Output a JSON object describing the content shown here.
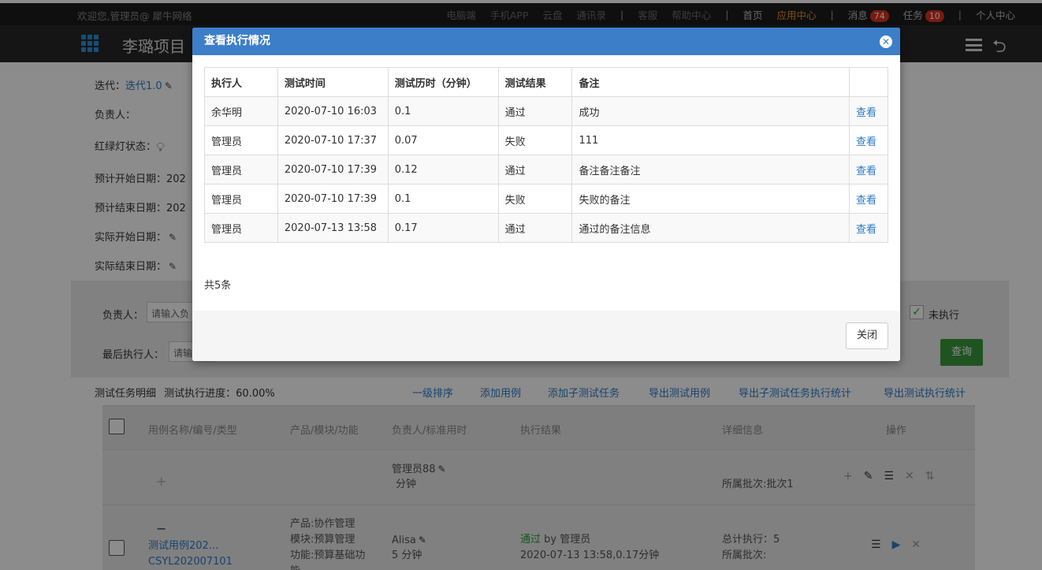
{
  "topbar": {
    "welcome": "欢迎您,管理员@ 犀牛网络",
    "links": [
      "电脑端",
      "手机APP",
      "云盘",
      "通讯录"
    ],
    "links2": [
      "客服",
      "帮助中心"
    ],
    "home": "首页",
    "app_center": "应用中心",
    "messages_label": "消息",
    "messages_count": "74",
    "tasks_label": "任务",
    "tasks_count": "10",
    "personal": "个人中心"
  },
  "project": {
    "name": "李璐项目"
  },
  "info": {
    "iteration_label": "迭代：",
    "iteration_value": "迭代1.0",
    "owner_label": "负责人：",
    "light_label": "红绿灯状态：",
    "plan_start_label": "预计开始日期：",
    "plan_start_value": "202",
    "plan_end_label": "预计结束日期：",
    "plan_end_value": "202",
    "actual_start_label": "实际开始日期：",
    "actual_end_label": "实际结束日期："
  },
  "filter": {
    "owner_label": "负责人：",
    "owner_placeholder": "请输入负",
    "last_exec_label": "最后执行人：",
    "last_exec_placeholder": "请输",
    "not_executed_label": "未执行",
    "query_button": "查询"
  },
  "progress": {
    "detail_label": "测试任务明细",
    "progress_label": "测试执行进度：60.00%"
  },
  "actions": [
    "一级排序",
    "添加用例",
    "添加子测试任务",
    "导出测试用例",
    "导出子测试任务执行统计",
    "导出测试执行统计"
  ],
  "main_table": {
    "headers": [
      "用例名称/编号/类型",
      "产品/模块/功能",
      "负责人/标准用时",
      "执行结果",
      "详细信息",
      "操作"
    ],
    "row1": {
      "owner": "管理员88",
      "time": "分钟",
      "batch": "所属批次:批次1"
    },
    "row2": {
      "name": "测试用例202...",
      "code": "CSYL202007101",
      "product": "产品:协作管理",
      "module": "模块:预算管理",
      "function": "功能:预算基础功",
      "function_cont": "能",
      "owner": "Alisa",
      "time": "5 分钟",
      "result_status": "通过",
      "result_by": " by 管理员",
      "result_detail": "2020-07-13 13:58,0.17分钟",
      "total_exec": "总计执行：5",
      "batch": "所属批次:"
    }
  },
  "modal": {
    "title": "查看执行情况",
    "headers": [
      "执行人",
      "测试时间",
      "测试历时（分钟）",
      "测试结果",
      "备注",
      ""
    ],
    "rows": [
      {
        "executor": "余华明",
        "time": "2020-07-10 16:03",
        "duration": "0.1",
        "result": "通过",
        "remark": "成功",
        "action": "查看"
      },
      {
        "executor": "管理员",
        "time": "2020-07-10 17:37",
        "duration": "0.07",
        "result": "失败",
        "remark": "111",
        "action": "查看"
      },
      {
        "executor": "管理员",
        "time": "2020-07-10 17:39",
        "duration": "0.12",
        "result": "通过",
        "remark": "备注备注备注",
        "action": "查看"
      },
      {
        "executor": "管理员",
        "time": "2020-07-10 17:39",
        "duration": "0.1",
        "result": "失败",
        "remark": "失败的备注",
        "action": "查看"
      },
      {
        "executor": "管理员",
        "time": "2020-07-13 13:58",
        "duration": "0.17",
        "result": "通过",
        "remark": "通过的备注信息",
        "action": "查看"
      }
    ],
    "total": "共5条",
    "close_button": "关闭"
  },
  "colors": {
    "accent_blue": "#3d7ec9",
    "link_blue": "#2b7cc6",
    "success_green": "#3a9a3d",
    "badge_red": "#d9331a",
    "app_center_orange": "#f08a24"
  }
}
